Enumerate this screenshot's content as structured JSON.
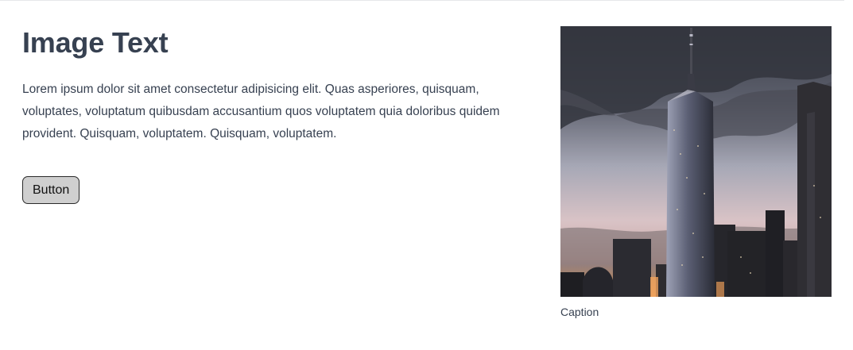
{
  "hero": {
    "heading": "Image Text",
    "body": "Lorem ipsum dolor sit amet consectetur adipisicing elit. Quas asperiores, quisquam, voluptates, voluptatum quibusdam accusantium quos voluptatem quia doloribus quidem provident. Quisquam, voluptatem. Quisquam, voluptatem.",
    "button_label": "Button"
  },
  "figure": {
    "caption": "Caption"
  },
  "colors": {
    "heading": "#374151",
    "body_text": "#374151",
    "button_bg": "#cfcfcf",
    "button_border": "#2a2a2a"
  }
}
